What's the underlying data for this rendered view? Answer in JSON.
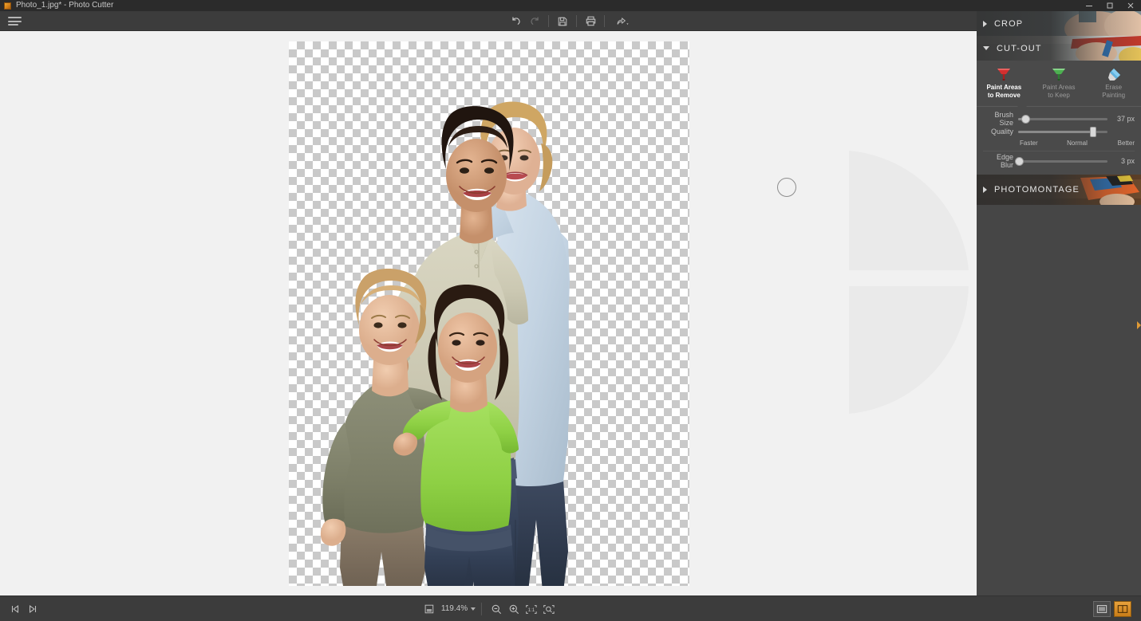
{
  "window": {
    "title": "Photo_1.jpg* - Photo Cutter",
    "app_icon": "app-icon",
    "minimize_label": "─",
    "maximize_label": "❐",
    "close_label": "✕"
  },
  "toolbar": {
    "menu_icon": "hamburger-menu-icon",
    "undo_label": "Undo",
    "redo_label": "Redo",
    "save_label": "Save",
    "print_label": "Print",
    "share_label": "Share"
  },
  "canvas": {
    "transparency_pattern": "checkerboard",
    "brush_cursor_size_px": 24
  },
  "panel": {
    "sections": [
      {
        "id": "crop",
        "title": "CROP",
        "expanded": false,
        "arrow": "chevron-right-icon"
      },
      {
        "id": "cutout",
        "title": "CUT-OUT",
        "expanded": true,
        "arrow": "chevron-down-icon"
      },
      {
        "id": "photomontage",
        "title": "PHOTOMONTAGE",
        "expanded": false,
        "arrow": "chevron-right-icon"
      }
    ],
    "cutout": {
      "tools": [
        {
          "id": "paint-remove",
          "line1": "Paint Areas",
          "line2": "to Remove",
          "color": "#d32f2f",
          "active": true
        },
        {
          "id": "paint-keep",
          "line1": "Paint Areas",
          "line2": "to Keep",
          "color": "#4caf50",
          "active": false
        },
        {
          "id": "erase",
          "line1": "Erase",
          "line2": "Painting",
          "color": "#4aa3d8",
          "active": false
        }
      ],
      "sliders": [
        {
          "id": "brush-size",
          "label": "Brush Size",
          "value": "37 px",
          "percent": 8
        },
        {
          "id": "quality",
          "label": "Quality",
          "value": "",
          "percent": 84
        },
        {
          "id": "edge-blur",
          "label": "Edge Blur",
          "value": "3 px",
          "percent": 1
        }
      ],
      "quality_ticks": [
        "Faster",
        "Normal",
        "Better"
      ]
    },
    "collapse_handle": "panel-collapse-handle"
  },
  "statusbar": {
    "prev_image_label": "Previous image",
    "next_image_label": "Next image",
    "fit_icon": "fit-page-icon",
    "zoom_value": "119.4%",
    "zoom_out_label": "Zoom out",
    "zoom_in_label": "Zoom in",
    "actual_size_label": "1:1",
    "fit_screen_label": "Fit to screen",
    "view_single_label": "Single view",
    "view_split_label": "Split view",
    "view_active": "split"
  },
  "colors": {
    "accent": "#e09a35",
    "panel_bg": "#464646",
    "toolbar_bg": "#3c3c3c",
    "canvas_bg": "#f1f1f1",
    "remove_red": "#d32f2f",
    "keep_green": "#4caf50",
    "erase_blue": "#4aa3d8"
  }
}
